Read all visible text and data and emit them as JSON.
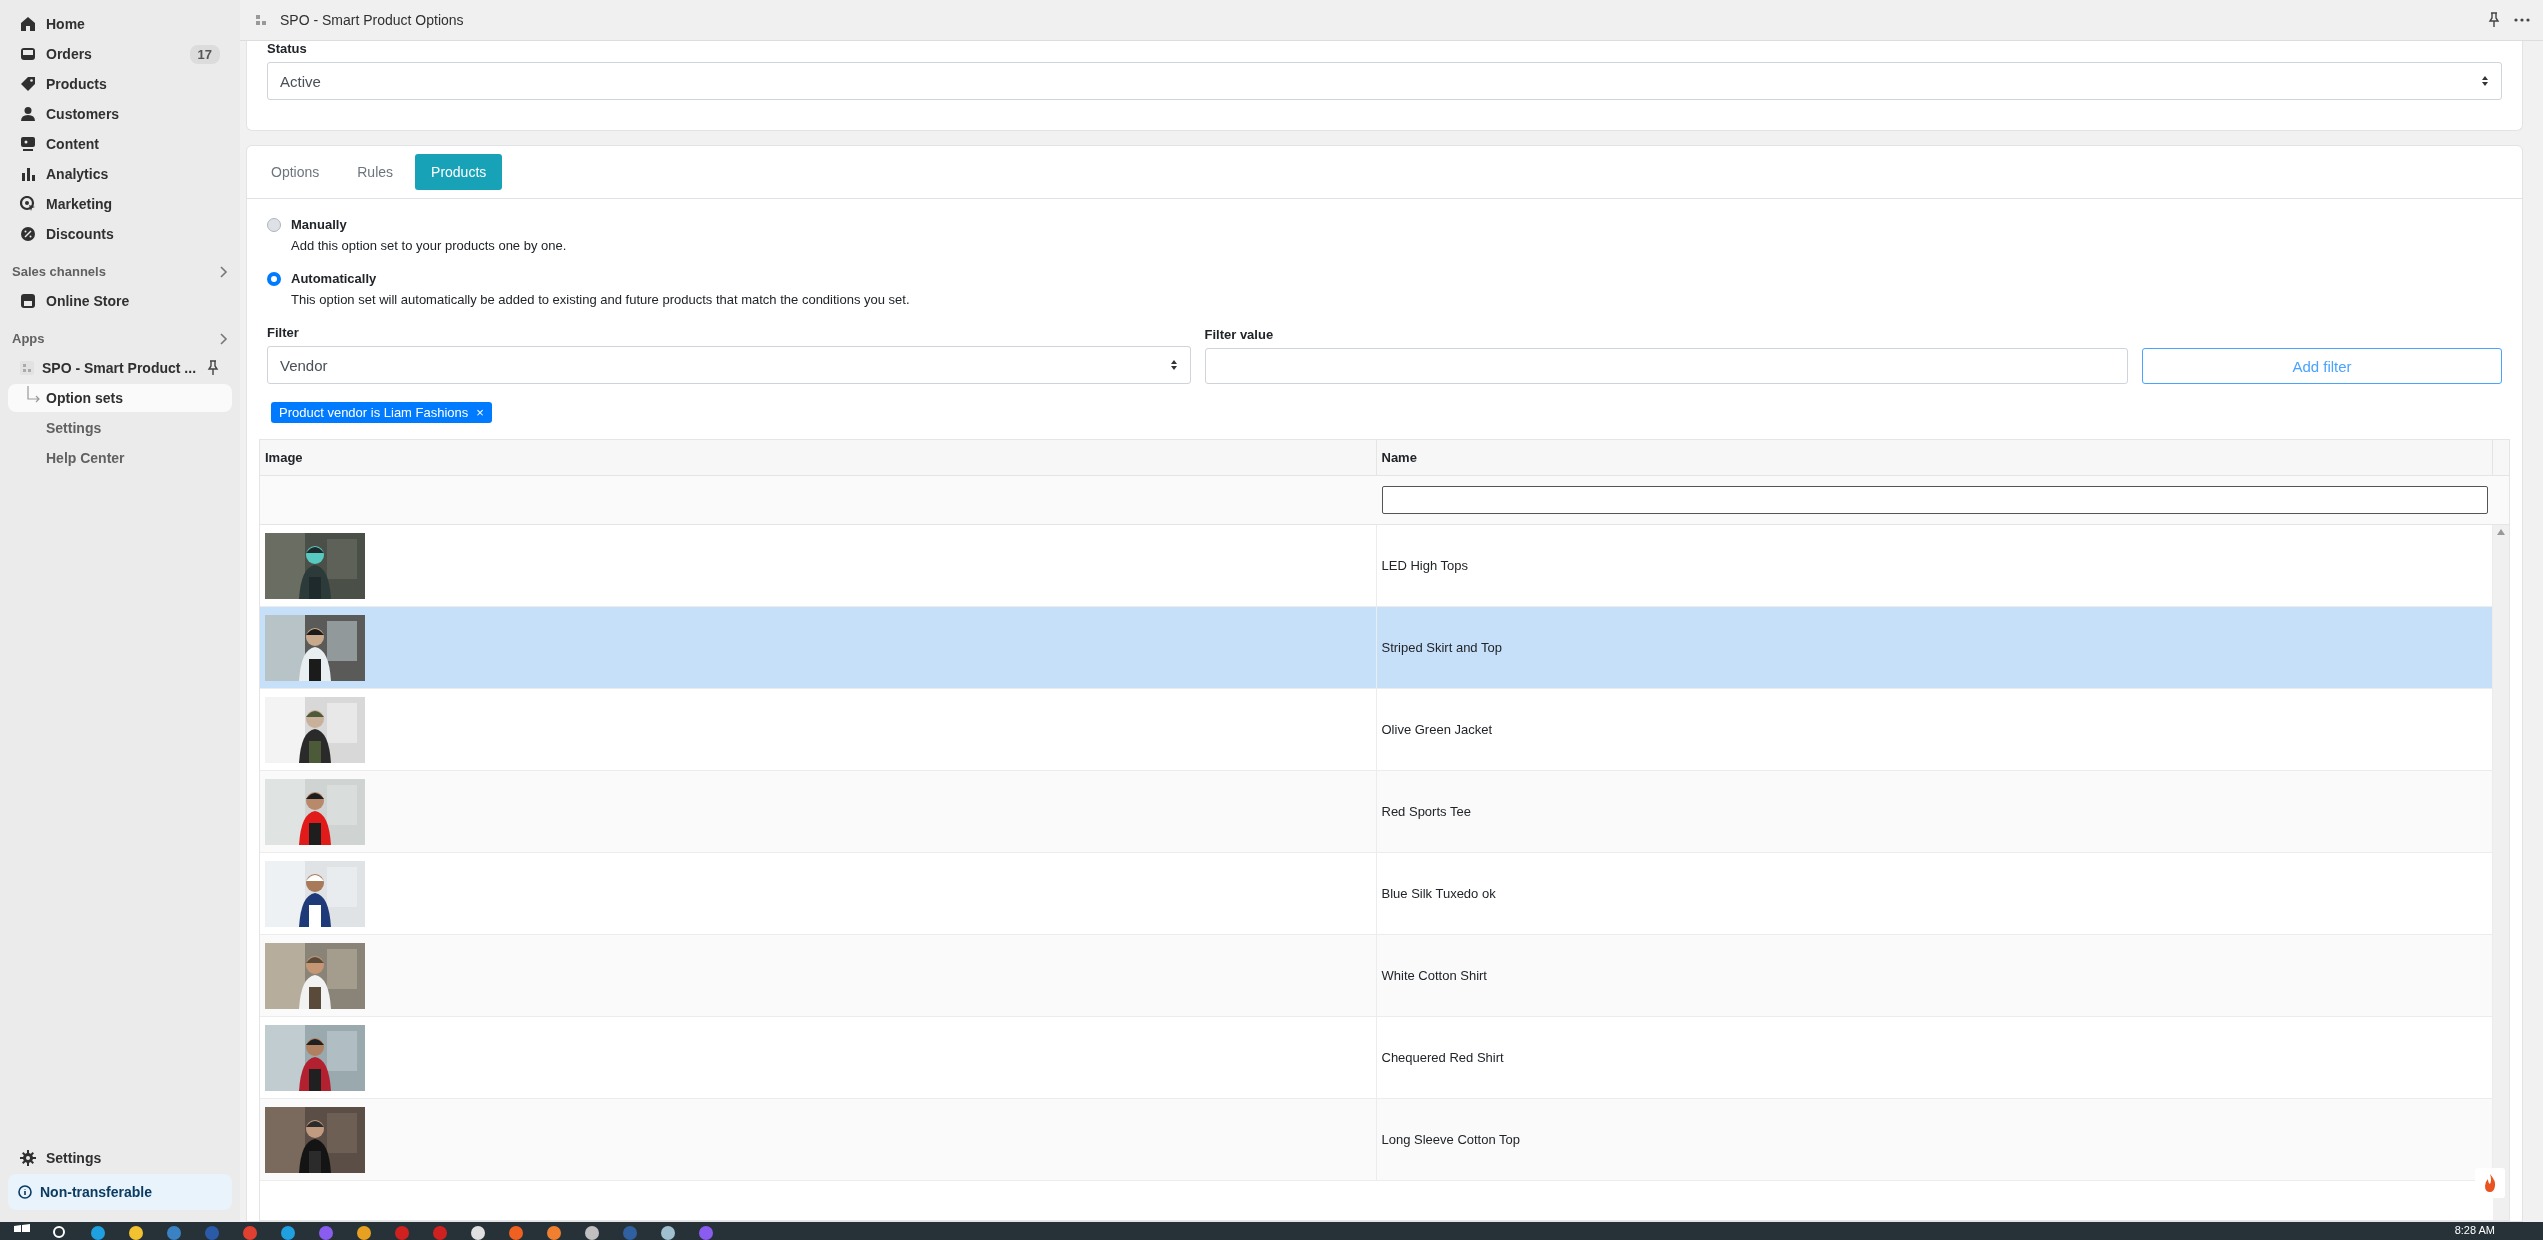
{
  "sidebar": {
    "nav": [
      {
        "label": "Home"
      },
      {
        "label": "Orders",
        "badge": "17"
      },
      {
        "label": "Products"
      },
      {
        "label": "Customers"
      },
      {
        "label": "Content"
      },
      {
        "label": "Analytics"
      },
      {
        "label": "Marketing"
      },
      {
        "label": "Discounts"
      }
    ],
    "sales_channels": {
      "title": "Sales channels",
      "items": [
        {
          "label": "Online Store"
        }
      ]
    },
    "apps": {
      "title": "Apps",
      "app": "SPO - Smart Product ...",
      "items": [
        {
          "label": "Option sets",
          "selected": true
        },
        {
          "label": "Settings",
          "selected": false
        },
        {
          "label": "Help Center",
          "selected": false
        }
      ]
    },
    "settings": "Settings",
    "plan": "Non-transferable"
  },
  "header": {
    "title": "SPO - Smart Product Options"
  },
  "status": {
    "label": "Status",
    "value": "Active"
  },
  "tabs": [
    {
      "label": "Options",
      "selected": false
    },
    {
      "label": "Rules",
      "selected": false
    },
    {
      "label": "Products",
      "selected": true
    }
  ],
  "assign": [
    {
      "label": "Manually",
      "description": "Add this option set to your products one by one.",
      "selected": false
    },
    {
      "label": "Automatically",
      "description": "This option set will automatically be added to existing and future products that match the conditions you set.",
      "selected": true
    }
  ],
  "filter": {
    "label": "Filter",
    "value": "Vendor",
    "value_label": "Filter value",
    "button": "Add filter"
  },
  "tags": [
    {
      "label": "Product vendor is Liam Fashions",
      "remove": "×"
    }
  ],
  "table": {
    "columns": [
      "Image",
      "Name"
    ],
    "rows": [
      {
        "name": "LED High Tops",
        "selected": false
      },
      {
        "name": "Striped Skirt and Top",
        "selected": true
      },
      {
        "name": "Olive Green Jacket",
        "selected": false
      },
      {
        "name": "Red Sports Tee",
        "selected": false
      },
      {
        "name": "Blue Silk Tuxedo ok",
        "selected": false
      },
      {
        "name": "White Cotton Shirt",
        "selected": false
      },
      {
        "name": "Chequered Red Shirt",
        "selected": false
      },
      {
        "name": "Long Sleeve Cotton Top",
        "selected": false
      }
    ]
  },
  "taskbar": {
    "time": "8:28 AM"
  }
}
